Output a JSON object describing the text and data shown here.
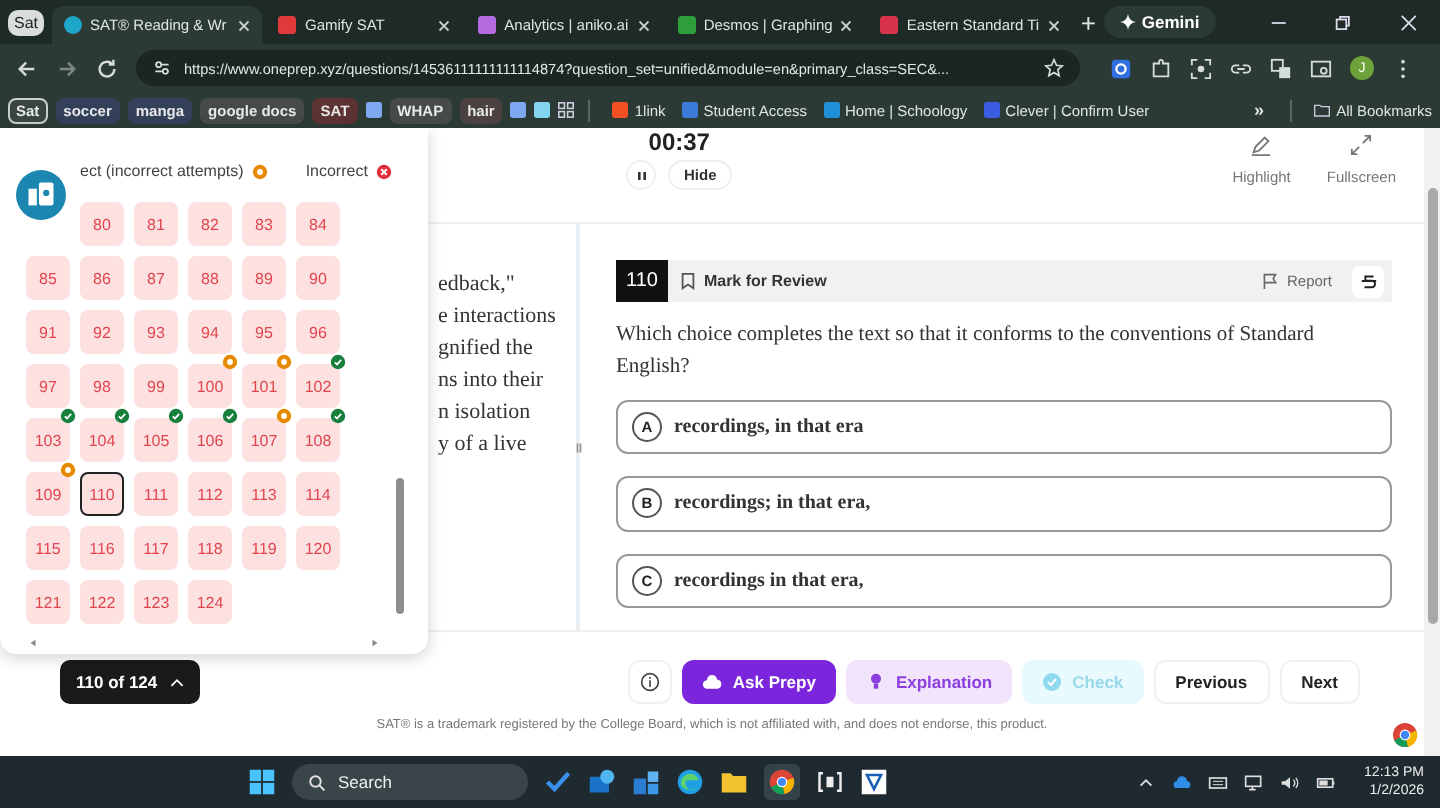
{
  "browser": {
    "profile_chip": "Sat",
    "tabs": [
      {
        "label": "SAT® Reading & Wr",
        "selected": true,
        "color": "#1ea7c9"
      },
      {
        "label": "Gamify SAT",
        "selected": false,
        "color": "#e03a3a"
      },
      {
        "label": "Analytics | aniko.ai",
        "selected": false,
        "color": "#b46be0"
      },
      {
        "label": "Desmos | Graphing",
        "selected": false,
        "color": "#2e9e3a"
      },
      {
        "label": "Eastern Standard Ti",
        "selected": false,
        "color": "#d8334a"
      }
    ],
    "new_tab": "+",
    "gemini": "Gemini",
    "url": "https://www.oneprep.xyz/questions/14536111111111114874?question_set=unified&module=en&primary_class=SEC&...",
    "avatar": "J",
    "bookmarks": [
      {
        "kind": "outlined",
        "label": "Sat",
        "color": "#3a4541"
      },
      {
        "kind": "chip",
        "label": "soccer",
        "color": "#34405a"
      },
      {
        "kind": "chip",
        "label": "manga",
        "color": "#34405a"
      },
      {
        "kind": "chip",
        "label": "google docs",
        "color": "#464b49"
      },
      {
        "kind": "chip",
        "label": "SAT",
        "color": "#5c3232"
      },
      {
        "kind": "square",
        "color": "#7ea9f2"
      },
      {
        "kind": "chip",
        "label": "WHAP",
        "color": "#464b49"
      },
      {
        "kind": "chip",
        "label": "hair",
        "color": "#4b4141"
      },
      {
        "kind": "square",
        "color": "#7ea9f2"
      },
      {
        "kind": "square",
        "color": "#84d6f0"
      },
      {
        "kind": "apps"
      },
      {
        "kind": "link",
        "label": "1link",
        "color": "#f25022"
      },
      {
        "kind": "link",
        "label": "Student Access",
        "color": "#3b7ad8"
      },
      {
        "kind": "link",
        "label": "Home | Schoology",
        "color": "#1f8fd6"
      },
      {
        "kind": "link",
        "label": "Clever | Confirm User",
        "color": "#3b5ce0"
      }
    ],
    "more": "»",
    "all_bookmarks": "All Bookmarks"
  },
  "page": {
    "timer": "00:37",
    "hide": "Hide",
    "tools": [
      {
        "label": "Highlight"
      },
      {
        "label": "Fullscreen"
      }
    ],
    "passage_lines": [
      "edback,\"",
      "e interactions",
      "gnified the",
      "ns into their",
      "n isolation",
      "y of a live"
    ],
    "question": {
      "number": "110",
      "mark_for_review": "Mark for Review",
      "marked": false,
      "report": "Report",
      "prompt": "Which choice completes the text so that it conforms to the conventions of Standard English?",
      "choices": [
        {
          "letter": "A",
          "text": "recordings, in that era",
          "selected": false
        },
        {
          "letter": "B",
          "text": "recordings; in that era,",
          "selected": false
        },
        {
          "letter": "C",
          "text": "recordings in that era,",
          "selected": false
        }
      ]
    },
    "navigator": {
      "legend": [
        {
          "kind": "attempted",
          "label": "ect (incorrect attempts)"
        },
        {
          "kind": "incorrect",
          "label": "Incorrect"
        }
      ],
      "items": [
        {
          "number": "80",
          "kind": "plain",
          "selected": false
        },
        {
          "number": "81",
          "kind": "plain",
          "selected": false
        },
        {
          "number": "82",
          "kind": "plain",
          "selected": false
        },
        {
          "number": "83",
          "kind": "plain",
          "selected": false
        },
        {
          "number": "84",
          "kind": "plain",
          "selected": false
        },
        {
          "number": "85",
          "kind": "plain",
          "selected": false
        },
        {
          "number": "86",
          "kind": "plain",
          "selected": false
        },
        {
          "number": "87",
          "kind": "plain",
          "selected": false
        },
        {
          "number": "88",
          "kind": "plain",
          "selected": false
        },
        {
          "number": "89",
          "kind": "plain",
          "selected": false
        },
        {
          "number": "90",
          "kind": "plain",
          "selected": false
        },
        {
          "number": "91",
          "kind": "plain",
          "selected": false
        },
        {
          "number": "92",
          "kind": "plain",
          "selected": false
        },
        {
          "number": "93",
          "kind": "plain",
          "selected": false
        },
        {
          "number": "94",
          "kind": "plain",
          "selected": false
        },
        {
          "number": "95",
          "kind": "plain",
          "selected": false
        },
        {
          "number": "96",
          "kind": "plain",
          "selected": false
        },
        {
          "number": "97",
          "kind": "plain",
          "selected": false
        },
        {
          "number": "98",
          "kind": "plain",
          "selected": false
        },
        {
          "number": "99",
          "kind": "plain",
          "selected": false
        },
        {
          "number": "100",
          "kind": "attempted",
          "selected": false
        },
        {
          "number": "101",
          "kind": "attempted",
          "selected": false
        },
        {
          "number": "102",
          "kind": "correct",
          "selected": false
        },
        {
          "number": "103",
          "kind": "correct",
          "selected": false
        },
        {
          "number": "104",
          "kind": "correct",
          "selected": false
        },
        {
          "number": "105",
          "kind": "correct",
          "selected": false
        },
        {
          "number": "106",
          "kind": "correct",
          "selected": false
        },
        {
          "number": "107",
          "kind": "attempted",
          "selected": false
        },
        {
          "number": "108",
          "kind": "correct",
          "selected": false
        },
        {
          "number": "109",
          "kind": "attempted",
          "selected": false
        },
        {
          "number": "110",
          "kind": "plain",
          "selected": true
        },
        {
          "number": "111",
          "kind": "plain",
          "selected": false
        },
        {
          "number": "112",
          "kind": "plain",
          "selected": false
        },
        {
          "number": "113",
          "kind": "plain",
          "selected": false
        },
        {
          "number": "114",
          "kind": "plain",
          "selected": false
        },
        {
          "number": "115",
          "kind": "plain",
          "selected": false
        },
        {
          "number": "116",
          "kind": "plain",
          "selected": false
        },
        {
          "number": "117",
          "kind": "plain",
          "selected": false
        },
        {
          "number": "118",
          "kind": "plain",
          "selected": false
        },
        {
          "number": "119",
          "kind": "plain",
          "selected": false
        },
        {
          "number": "120",
          "kind": "plain",
          "selected": false
        },
        {
          "number": "121",
          "kind": "plain",
          "selected": false
        },
        {
          "number": "122",
          "kind": "plain",
          "selected": false
        },
        {
          "number": "123",
          "kind": "plain",
          "selected": false
        },
        {
          "number": "124",
          "kind": "plain",
          "selected": false
        }
      ],
      "toggle": "110 of 124"
    },
    "actions": {
      "ask": "Ask Prepy",
      "explanation": "Explanation",
      "check": "Check",
      "check_disabled": true,
      "previous": "Previous",
      "next": "Next"
    },
    "footer": "SAT® is a trademark registered by the College Board, which is not affiliated with, and does not endorse, this product."
  },
  "taskbar": {
    "search": "Search",
    "time": "12:13 PM",
    "date": "1/2/2026"
  }
}
